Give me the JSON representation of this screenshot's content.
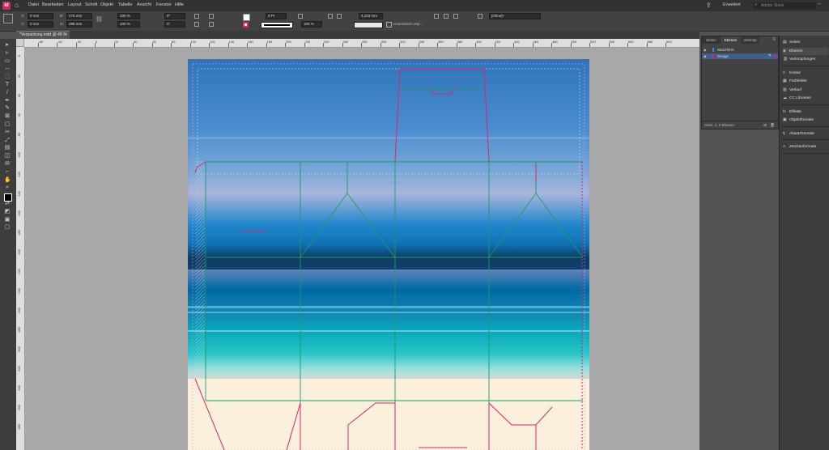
{
  "app": {
    "logo": "Id",
    "home_icon": "home-icon"
  },
  "menu": [
    "Datei",
    "Bearbeiten",
    "Layout",
    "Schrift",
    "Objekt",
    "Tabelle",
    "Ansicht",
    "Fenster",
    "Hilfe"
  ],
  "header": {
    "workspace": "Erweitert",
    "search_placeholder": "Adobe Stock"
  },
  "control": {
    "x_label": "X:",
    "x_value": "0 mm",
    "y_label": "Y:",
    "y_value": "0 mm",
    "w_label": "B:",
    "w_value": "475 mm",
    "h_label": "H:",
    "h_value": "498 mm",
    "scale_x": "100 %",
    "scale_y": "100 %",
    "rotate": "0°",
    "shear": "0°",
    "stroke_weight": "0 Pt",
    "opacity": "100 %",
    "offset": "4,233 mm",
    "auto_fit": "Automatisch anp...",
    "style": "[Ohne]+"
  },
  "document_tab": {
    "title": "*Verpackung.indd @ 48 %",
    "close": "×"
  },
  "ruler_h": [
    "-80",
    "-60",
    "-40",
    "-20",
    "0",
    "20",
    "40",
    "60",
    "80",
    "100",
    "120",
    "140",
    "160",
    "180",
    "200",
    "220",
    "240",
    "260",
    "280",
    "300",
    "320",
    "340",
    "360",
    "380",
    "400",
    "420",
    "440",
    "460",
    "480",
    "500",
    "520",
    "540",
    "560",
    "580",
    "600"
  ],
  "ruler_v": [
    "0",
    "20",
    "40",
    "60",
    "80",
    "100",
    "120",
    "140",
    "160",
    "180",
    "200",
    "220",
    "240",
    "260",
    "280",
    "300",
    "320",
    "340",
    "360",
    "380"
  ],
  "tools": [
    "selection-tool-icon",
    "direct-selection-tool-icon",
    "page-tool-icon",
    "gap-tool-icon",
    "content-collector-icon",
    "type-tool-icon",
    "line-tool-icon",
    "pen-tool-icon",
    "pencil-tool-icon",
    "rectangle-frame-tool-icon",
    "rectangle-tool-icon",
    "scissors-tool-icon",
    "free-transform-tool-icon",
    "gradient-swatch-tool-icon",
    "gradient-feather-tool-icon",
    "note-tool-icon",
    "eyedropper-tool-icon",
    "hand-tool-icon",
    "zoom-tool-icon",
    "fill-stroke-icon",
    "swap-colors-icon",
    "default-colors-icon",
    "apply-color-icon",
    "screen-mode-icon"
  ],
  "layers_panel": {
    "tabs": [
      "Seiten",
      "Ebenen",
      "Verknüp"
    ],
    "layers": [
      {
        "name": "Stanzform",
        "color": "#4a7fd6"
      },
      {
        "name": "Design",
        "color": "#e0226b"
      }
    ],
    "footer": "Seite: 1, 2 Ebenen"
  },
  "dock": {
    "groups": [
      [
        {
          "label": "Seiten",
          "icon": "pages-icon"
        },
        {
          "label": "Ebenen",
          "icon": "layers-icon"
        },
        {
          "label": "Verknüpfungen",
          "icon": "links-icon"
        }
      ],
      [
        {
          "label": "Kontur",
          "icon": "stroke-icon"
        },
        {
          "label": "Farbfelder",
          "icon": "swatches-icon"
        },
        {
          "label": "Verlauf",
          "icon": "gradient-icon"
        },
        {
          "label": "CC Libraries",
          "icon": "cc-libraries-icon"
        }
      ],
      [
        {
          "label": "Effekte",
          "icon": "effects-icon"
        },
        {
          "label": "Objektformate",
          "icon": "object-styles-icon"
        }
      ],
      [
        {
          "label": "Absatzformate",
          "icon": "paragraph-styles-icon"
        }
      ],
      [
        {
          "label": "Zeichenformate",
          "icon": "character-styles-icon"
        }
      ]
    ]
  },
  "colors": {
    "dieline_magenta": "#e0226b",
    "dieline_green": "#1f9a6a",
    "paper": "#faf0dc",
    "accent": "#3f5f8a"
  }
}
